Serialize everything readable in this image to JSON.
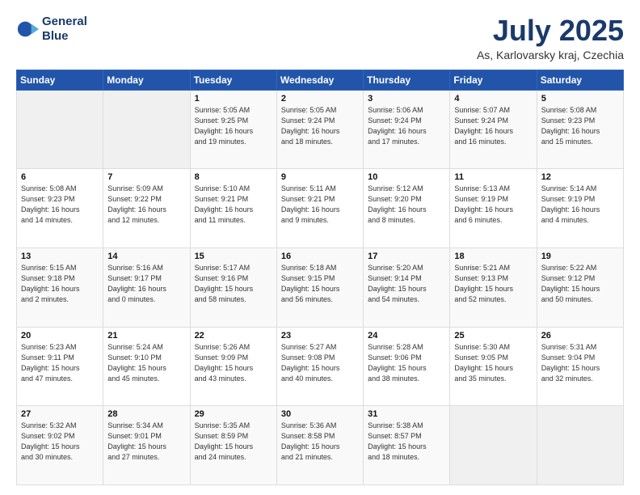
{
  "header": {
    "logo_line1": "General",
    "logo_line2": "Blue",
    "title": "July 2025",
    "subtitle": "As, Karlovarsky kraj, Czechia"
  },
  "weekdays": [
    "Sunday",
    "Monday",
    "Tuesday",
    "Wednesday",
    "Thursday",
    "Friday",
    "Saturday"
  ],
  "weeks": [
    [
      {
        "num": "",
        "info": ""
      },
      {
        "num": "",
        "info": ""
      },
      {
        "num": "1",
        "info": "Sunrise: 5:05 AM\nSunset: 9:25 PM\nDaylight: 16 hours\nand 19 minutes."
      },
      {
        "num": "2",
        "info": "Sunrise: 5:05 AM\nSunset: 9:24 PM\nDaylight: 16 hours\nand 18 minutes."
      },
      {
        "num": "3",
        "info": "Sunrise: 5:06 AM\nSunset: 9:24 PM\nDaylight: 16 hours\nand 17 minutes."
      },
      {
        "num": "4",
        "info": "Sunrise: 5:07 AM\nSunset: 9:24 PM\nDaylight: 16 hours\nand 16 minutes."
      },
      {
        "num": "5",
        "info": "Sunrise: 5:08 AM\nSunset: 9:23 PM\nDaylight: 16 hours\nand 15 minutes."
      }
    ],
    [
      {
        "num": "6",
        "info": "Sunrise: 5:08 AM\nSunset: 9:23 PM\nDaylight: 16 hours\nand 14 minutes."
      },
      {
        "num": "7",
        "info": "Sunrise: 5:09 AM\nSunset: 9:22 PM\nDaylight: 16 hours\nand 12 minutes."
      },
      {
        "num": "8",
        "info": "Sunrise: 5:10 AM\nSunset: 9:21 PM\nDaylight: 16 hours\nand 11 minutes."
      },
      {
        "num": "9",
        "info": "Sunrise: 5:11 AM\nSunset: 9:21 PM\nDaylight: 16 hours\nand 9 minutes."
      },
      {
        "num": "10",
        "info": "Sunrise: 5:12 AM\nSunset: 9:20 PM\nDaylight: 16 hours\nand 8 minutes."
      },
      {
        "num": "11",
        "info": "Sunrise: 5:13 AM\nSunset: 9:19 PM\nDaylight: 16 hours\nand 6 minutes."
      },
      {
        "num": "12",
        "info": "Sunrise: 5:14 AM\nSunset: 9:19 PM\nDaylight: 16 hours\nand 4 minutes."
      }
    ],
    [
      {
        "num": "13",
        "info": "Sunrise: 5:15 AM\nSunset: 9:18 PM\nDaylight: 16 hours\nand 2 minutes."
      },
      {
        "num": "14",
        "info": "Sunrise: 5:16 AM\nSunset: 9:17 PM\nDaylight: 16 hours\nand 0 minutes."
      },
      {
        "num": "15",
        "info": "Sunrise: 5:17 AM\nSunset: 9:16 PM\nDaylight: 15 hours\nand 58 minutes."
      },
      {
        "num": "16",
        "info": "Sunrise: 5:18 AM\nSunset: 9:15 PM\nDaylight: 15 hours\nand 56 minutes."
      },
      {
        "num": "17",
        "info": "Sunrise: 5:20 AM\nSunset: 9:14 PM\nDaylight: 15 hours\nand 54 minutes."
      },
      {
        "num": "18",
        "info": "Sunrise: 5:21 AM\nSunset: 9:13 PM\nDaylight: 15 hours\nand 52 minutes."
      },
      {
        "num": "19",
        "info": "Sunrise: 5:22 AM\nSunset: 9:12 PM\nDaylight: 15 hours\nand 50 minutes."
      }
    ],
    [
      {
        "num": "20",
        "info": "Sunrise: 5:23 AM\nSunset: 9:11 PM\nDaylight: 15 hours\nand 47 minutes."
      },
      {
        "num": "21",
        "info": "Sunrise: 5:24 AM\nSunset: 9:10 PM\nDaylight: 15 hours\nand 45 minutes."
      },
      {
        "num": "22",
        "info": "Sunrise: 5:26 AM\nSunset: 9:09 PM\nDaylight: 15 hours\nand 43 minutes."
      },
      {
        "num": "23",
        "info": "Sunrise: 5:27 AM\nSunset: 9:08 PM\nDaylight: 15 hours\nand 40 minutes."
      },
      {
        "num": "24",
        "info": "Sunrise: 5:28 AM\nSunset: 9:06 PM\nDaylight: 15 hours\nand 38 minutes."
      },
      {
        "num": "25",
        "info": "Sunrise: 5:30 AM\nSunset: 9:05 PM\nDaylight: 15 hours\nand 35 minutes."
      },
      {
        "num": "26",
        "info": "Sunrise: 5:31 AM\nSunset: 9:04 PM\nDaylight: 15 hours\nand 32 minutes."
      }
    ],
    [
      {
        "num": "27",
        "info": "Sunrise: 5:32 AM\nSunset: 9:02 PM\nDaylight: 15 hours\nand 30 minutes."
      },
      {
        "num": "28",
        "info": "Sunrise: 5:34 AM\nSunset: 9:01 PM\nDaylight: 15 hours\nand 27 minutes."
      },
      {
        "num": "29",
        "info": "Sunrise: 5:35 AM\nSunset: 8:59 PM\nDaylight: 15 hours\nand 24 minutes."
      },
      {
        "num": "30",
        "info": "Sunrise: 5:36 AM\nSunset: 8:58 PM\nDaylight: 15 hours\nand 21 minutes."
      },
      {
        "num": "31",
        "info": "Sunrise: 5:38 AM\nSunset: 8:57 PM\nDaylight: 15 hours\nand 18 minutes."
      },
      {
        "num": "",
        "info": ""
      },
      {
        "num": "",
        "info": ""
      }
    ]
  ]
}
